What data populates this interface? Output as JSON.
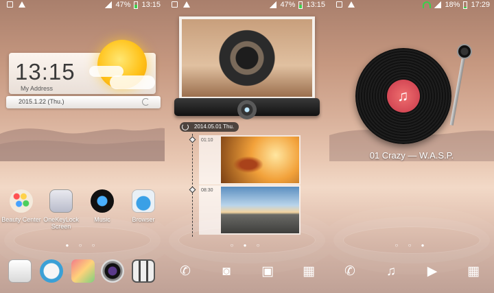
{
  "panels": {
    "home": {
      "status": {
        "battery": "47%",
        "time": "13:15"
      },
      "clock_widget": {
        "time": "13:15",
        "address": "My Address",
        "date": "2015.1.22 (Thu.)"
      },
      "apps": [
        {
          "label": "Beauty Center",
          "icon": "palette-icon"
        },
        {
          "label": "OneKeyLock Screen",
          "icon": "lock-icon"
        },
        {
          "label": "Music",
          "icon": "music-icon"
        },
        {
          "label": "Browser",
          "icon": "browser-icon"
        }
      ],
      "dock": [
        "dialer-icon",
        "messages-icon",
        "gallery-icon",
        "camera-icon",
        "apps-grid-icon"
      ]
    },
    "gallery": {
      "status": {
        "battery": "47%",
        "time": "13:15"
      },
      "timeline_date": "2014.05.01 Thu.",
      "entries": [
        {
          "time": "01:10",
          "image": "autumn-leaf-photo"
        },
        {
          "time": "08:30",
          "image": "road-sky-photo"
        }
      ],
      "nav": [
        "phone-icon",
        "camera-icon",
        "image-icon",
        "grid-icon"
      ]
    },
    "music": {
      "status": {
        "battery": "18%",
        "time": "17:29"
      },
      "song": "01 Crazy — W.A.S.P.",
      "nav": [
        "phone-icon",
        "music-note-icon",
        "video-icon",
        "grid-icon"
      ]
    }
  },
  "colors": {
    "battery_green": "#3ed14c",
    "label_red": "#d94b5a"
  }
}
